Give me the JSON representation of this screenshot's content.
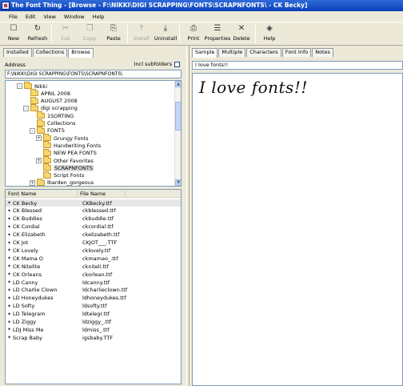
{
  "window": {
    "title": "The Font Thing - [Browse - F:\\NIKKI\\DIGI SCRAPPING\\FONTS\\SCRAPNFONTS\\ - CK Becky]"
  },
  "menu": [
    "File",
    "Edit",
    "View",
    "Window",
    "Help"
  ],
  "toolbar": [
    {
      "label": "New",
      "icon": "new-window-icon",
      "glyph": "☐",
      "enabled": true
    },
    {
      "label": "Refresh",
      "icon": "refresh-icon",
      "glyph": "↻",
      "enabled": true
    },
    {
      "label": "Cut",
      "icon": "cut-icon",
      "glyph": "✂",
      "enabled": false
    },
    {
      "label": "Copy",
      "icon": "copy-icon",
      "glyph": "❐",
      "enabled": false
    },
    {
      "label": "Paste",
      "icon": "paste-icon",
      "glyph": "⎘",
      "enabled": true
    },
    {
      "label": "Install",
      "icon": "install-icon",
      "glyph": "⤒",
      "enabled": false
    },
    {
      "label": "Uninstall",
      "icon": "uninstall-icon",
      "glyph": "⤓",
      "enabled": true
    },
    {
      "label": "Print",
      "icon": "print-icon",
      "glyph": "⎙",
      "enabled": true
    },
    {
      "label": "Properties",
      "icon": "properties-icon",
      "glyph": "☰",
      "enabled": true
    },
    {
      "label": "Delete",
      "icon": "delete-icon",
      "glyph": "✕",
      "enabled": true
    },
    {
      "label": "Help",
      "icon": "help-icon",
      "glyph": "◈",
      "enabled": true
    }
  ],
  "left": {
    "tabs": [
      "Installed",
      "Collections",
      "Browse"
    ],
    "active_tab": "Browse",
    "address_label": "Address",
    "include_subfolders_label": "Incl subfolders",
    "address_value": "F:\\NIKKI\\DIGI SCRAPPING\\FONTS\\SCRAPNFONTS\\",
    "tree": [
      {
        "label": "Nikki",
        "depth": 1,
        "expander": "-"
      },
      {
        "label": "APRIL 2008",
        "depth": 2,
        "expander": ""
      },
      {
        "label": "AUGUST 2008",
        "depth": 2,
        "expander": ""
      },
      {
        "label": "digi scrapping",
        "depth": 2,
        "expander": "-"
      },
      {
        "label": "1SORTING",
        "depth": 3,
        "expander": ""
      },
      {
        "label": "Collections",
        "depth": 3,
        "expander": ""
      },
      {
        "label": "FONTS",
        "depth": 3,
        "expander": "-"
      },
      {
        "label": "Grungy Fonts",
        "depth": 4,
        "expander": "+"
      },
      {
        "label": "Handwriting Fonts",
        "depth": 4,
        "expander": ""
      },
      {
        "label": "NEW PEA FONTS",
        "depth": 4,
        "expander": ""
      },
      {
        "label": "Other Favorites",
        "depth": 4,
        "expander": "+"
      },
      {
        "label": "SCRAPNFONTS",
        "depth": 4,
        "expander": "",
        "selected": true
      },
      {
        "label": "Script Fonts",
        "depth": 4,
        "expander": ""
      },
      {
        "label": "lbarden_gorgeous",
        "depth": 3,
        "expander": "+"
      }
    ],
    "columns": [
      "Font Name",
      "File Name"
    ],
    "fonts": [
      {
        "name": "CK Becky",
        "file": "CKBecky.ttf",
        "selected": true
      },
      {
        "name": "CK Blessed",
        "file": "ckblessed.ttf"
      },
      {
        "name": "CK Buddies",
        "file": "ckbuddie.ttf"
      },
      {
        "name": "CK Cordial",
        "file": "ckcordial.ttf"
      },
      {
        "name": "CK Elizabeth",
        "file": "ckelizabeth.ttf"
      },
      {
        "name": "CK Jot",
        "file": "CKJOT___.TTF"
      },
      {
        "name": "CK Lovely",
        "file": "cklovely.ttf"
      },
      {
        "name": "CK Mama O",
        "file": "ckmamao_.ttf"
      },
      {
        "name": "CK Nitelite",
        "file": "ckniteli.ttf"
      },
      {
        "name": "CK Orleans",
        "file": "ckorlean.ttf"
      },
      {
        "name": "LD Canny",
        "file": "ldcanny.ttf"
      },
      {
        "name": "LD Charlie Clown",
        "file": "ldcharlieclown.ttf"
      },
      {
        "name": "LD Honeydukes",
        "file": "ldhoneydukes.ttf"
      },
      {
        "name": "LD Softy",
        "file": "ldsofty.ttf"
      },
      {
        "name": "LD Telegram",
        "file": "ldtelegr.ttf"
      },
      {
        "name": "LD Ziggy",
        "file": "ldziggy_.ttf"
      },
      {
        "name": "LDJ Miss Me",
        "file": "ldmiss_.ttf"
      },
      {
        "name": "Scrap Baby",
        "file": "igsbaby.TTF"
      }
    ]
  },
  "right": {
    "tabs": [
      "Sample",
      "Multiple",
      "Characters",
      "Font Info",
      "Notes"
    ],
    "active_tab": "Sample",
    "sample_input": "I love fonts!!",
    "sample_display": "I love fonts!!"
  },
  "colors": {
    "titlebar": "#0a3fb8",
    "chrome": "#ece9d8",
    "folder": "#f5d66d"
  }
}
